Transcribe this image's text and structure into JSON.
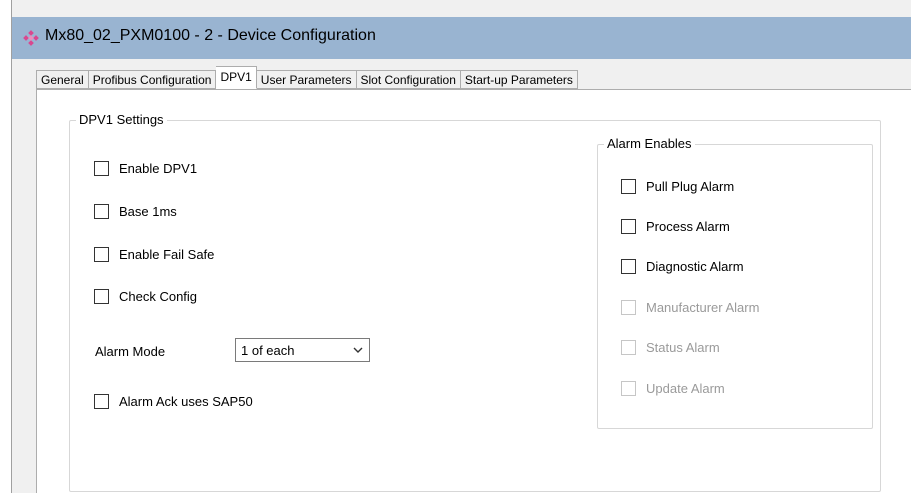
{
  "window": {
    "title": "Mx80_02_PXM0100 - 2 - Device Configuration",
    "accent": "#99b4d1",
    "icon": "device-diamond-icon"
  },
  "tabs": [
    {
      "label": "General",
      "active": false
    },
    {
      "label": "Profibus Configuration",
      "active": false
    },
    {
      "label": "DPV1",
      "active": true
    },
    {
      "label": "User Parameters",
      "active": false
    },
    {
      "label": "Slot Configuration",
      "active": false
    },
    {
      "label": "Start-up Parameters",
      "active": false
    }
  ],
  "dpv1_settings": {
    "title": "DPV1 Settings",
    "enable_dpv1": {
      "label": "Enable DPV1",
      "checked": false
    },
    "base_1ms": {
      "label": "Base 1ms",
      "checked": false
    },
    "enable_fail_safe": {
      "label": "Enable Fail Safe",
      "checked": false
    },
    "check_config": {
      "label": "Check Config",
      "checked": false
    },
    "alarm_mode": {
      "label": "Alarm Mode",
      "value": "1 of each"
    },
    "alarm_ack": {
      "label": "Alarm Ack uses SAP50",
      "checked": false
    }
  },
  "alarm_enables": {
    "title": "Alarm Enables",
    "pull_plug": {
      "label": "Pull Plug Alarm",
      "checked": false,
      "enabled": true
    },
    "process": {
      "label": "Process Alarm",
      "checked": false,
      "enabled": true
    },
    "diagnostic": {
      "label": "Diagnostic Alarm",
      "checked": false,
      "enabled": true
    },
    "manufacturer": {
      "label": "Manufacturer Alarm",
      "checked": false,
      "enabled": false
    },
    "status": {
      "label": "Status Alarm",
      "checked": false,
      "enabled": false
    },
    "update": {
      "label": "Update Alarm",
      "checked": false,
      "enabled": false
    }
  }
}
